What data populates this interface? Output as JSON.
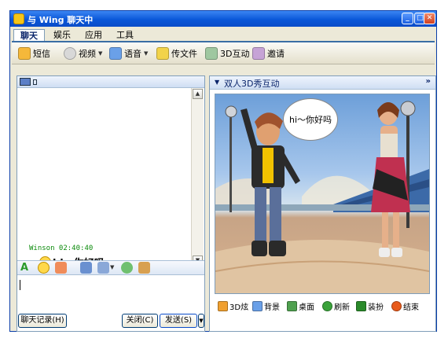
{
  "window": {
    "title": "与 Wing 聊天中",
    "minimize": "_",
    "maximize": "□",
    "close": "✕"
  },
  "menu": {
    "items": [
      "聊天",
      "娱乐",
      "应用",
      "工具"
    ]
  },
  "toolbar": {
    "sms": "短信",
    "video": "视频",
    "voice": "语音",
    "file": "传文件",
    "interact3d": "3D互动",
    "invite": "邀请"
  },
  "chat": {
    "message": {
      "sender_time": "Winson 02:40:40",
      "text": "hi～你好吗"
    },
    "input_value": ""
  },
  "buttons": {
    "history": "聊天记录(H)",
    "close": "关闭(C)",
    "send": "发送(S)"
  },
  "show3d": {
    "panel_title": "双人3D秀互动",
    "expand": "»",
    "speech": "hi～你好吗",
    "actions": [
      "3D炫",
      "背景",
      "桌面",
      "刷新",
      "装扮",
      "结束"
    ]
  },
  "icons": {
    "sms": "sms-icon",
    "video": "video-icon",
    "voice": "voice-icon",
    "file": "file-transfer-icon",
    "interact3d": "3d-interact-icon",
    "invite": "invite-icon"
  },
  "colors": {
    "titlebar": "#0a57d8",
    "accent_green": "#0a8a0a",
    "panel_border": "#7f9db9"
  }
}
